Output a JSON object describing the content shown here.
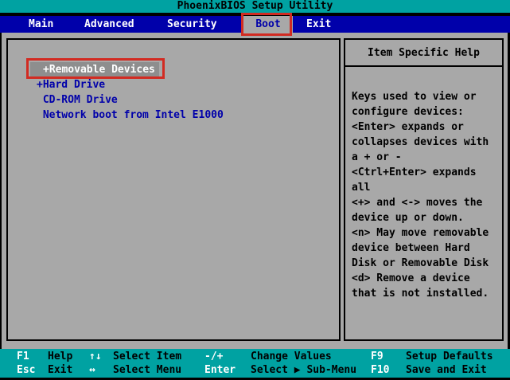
{
  "title_bar": {
    "title": "PhoenixBIOS Setup Utility"
  },
  "menu_bar": {
    "items": [
      {
        "label": "Main",
        "selected": false
      },
      {
        "label": "Advanced",
        "selected": false
      },
      {
        "label": "Security",
        "selected": false
      },
      {
        "label": "Boot",
        "selected": true
      },
      {
        "label": "Exit",
        "selected": false
      }
    ]
  },
  "boot_list": {
    "items": [
      {
        "label": "+Removable Devices",
        "selected": true
      },
      {
        "label": "+Hard Drive",
        "selected": false
      },
      {
        "label": " CD-ROM Drive",
        "selected": false
      },
      {
        "label": " Network boot from Intel E1000",
        "selected": false
      }
    ]
  },
  "help_panel": {
    "title": "Item Specific Help",
    "lines": [
      "Keys used to view or",
      "configure devices:",
      "<Enter> expands or",
      "collapses devices with",
      "a + or -",
      "<Ctrl+Enter> expands",
      "all",
      "<+> and <-> moves the",
      "device up or down.",
      "<n> May move removable",
      "device between Hard",
      "Disk or Removable Disk",
      "<d> Remove a device",
      "that is not installed."
    ]
  },
  "footer": {
    "row1": [
      {
        "key": "F1",
        "desc": "Help"
      },
      {
        "key": "↑↓",
        "desc": "Select Item"
      },
      {
        "key": "-/+",
        "desc": "Change Values"
      },
      {
        "key": "F9",
        "desc": "Setup Defaults"
      }
    ],
    "row2": [
      {
        "key": "Esc",
        "desc": "Exit"
      },
      {
        "key": "↔",
        "desc": "Select Menu"
      },
      {
        "key": "Enter",
        "desc": "Select ▶ Sub-Menu"
      },
      {
        "key": "F10",
        "desc": "Save and Exit"
      }
    ]
  },
  "annotations": {
    "boxes": [
      "boot-tab-highlight",
      "removable-devices-highlight"
    ],
    "color": "#d22b22"
  },
  "colors": {
    "teal": "#00a2a2",
    "menu_blue": "#0000aa",
    "bg_gray": "#a8a8a8",
    "item_text_blue": "#0000aa",
    "selected_item_bg": "#8e8e8e",
    "annotation_red": "#d22b22"
  }
}
